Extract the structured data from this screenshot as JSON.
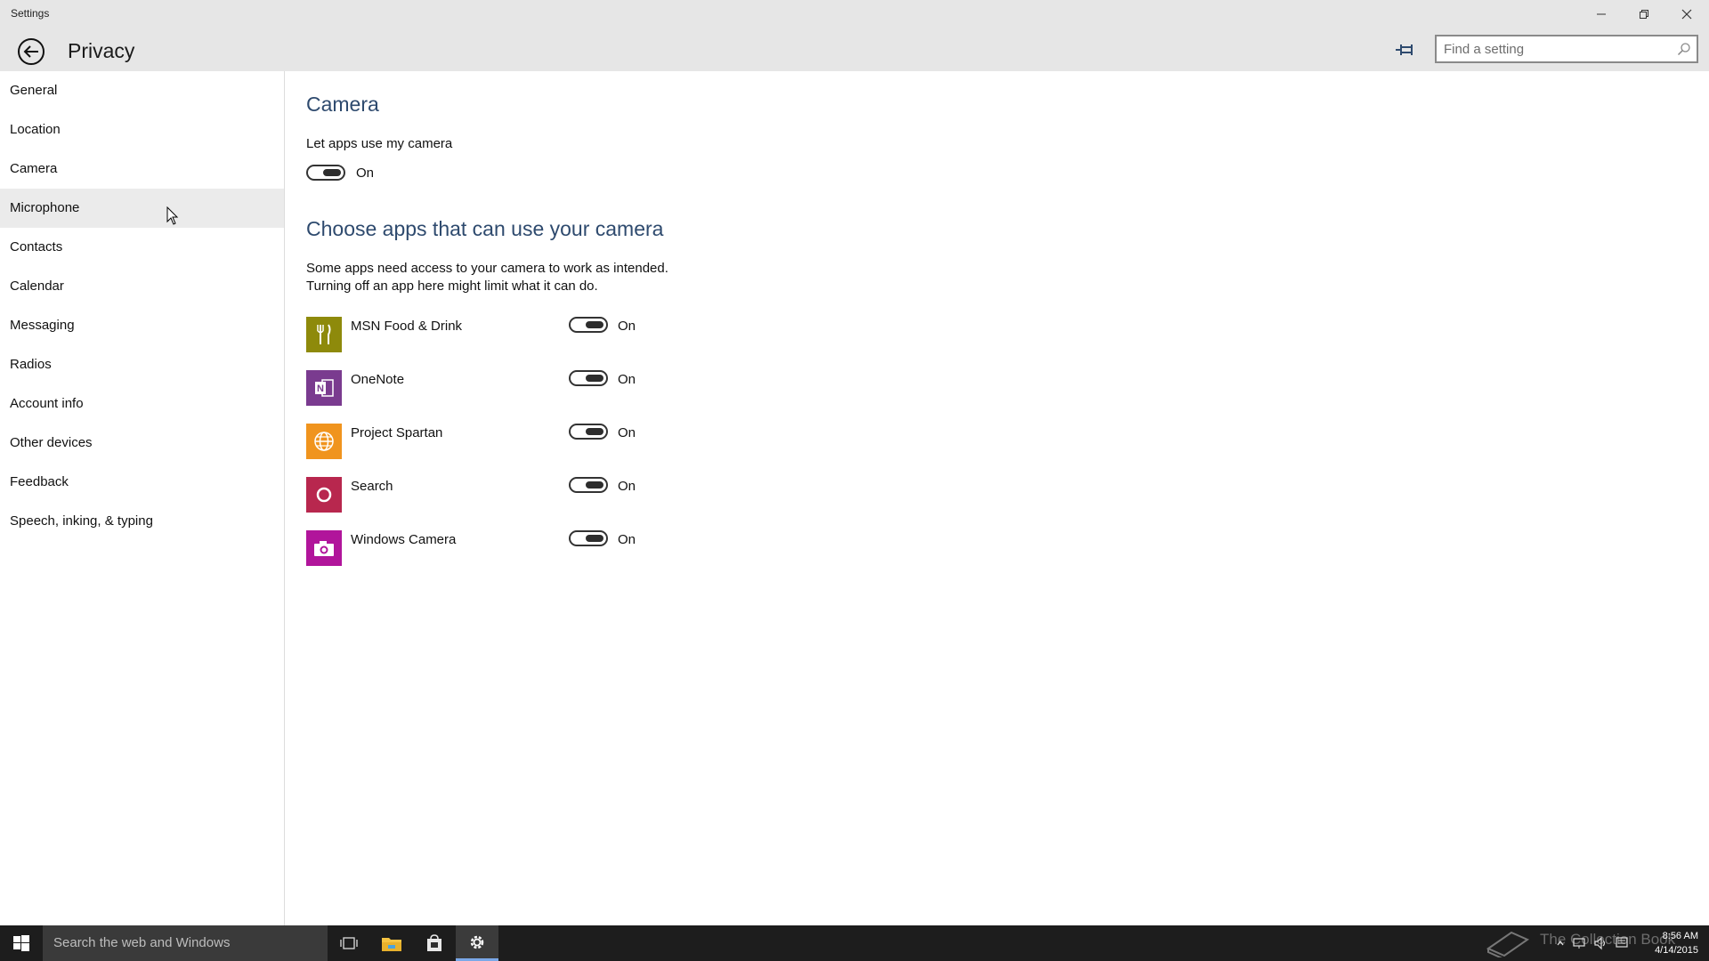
{
  "window": {
    "title": "Settings"
  },
  "header": {
    "title": "Privacy",
    "search_placeholder": "Find a setting"
  },
  "sidebar": {
    "items": [
      {
        "label": "General"
      },
      {
        "label": "Location"
      },
      {
        "label": "Camera"
      },
      {
        "label": "Microphone"
      },
      {
        "label": "Contacts"
      },
      {
        "label": "Calendar"
      },
      {
        "label": "Messaging"
      },
      {
        "label": "Radios"
      },
      {
        "label": "Account info"
      },
      {
        "label": "Other devices"
      },
      {
        "label": "Feedback"
      },
      {
        "label": "Speech, inking, & typing"
      }
    ]
  },
  "content": {
    "camera_heading": "Camera",
    "let_apps_label": "Let apps use my camera",
    "master_toggle_state": "On",
    "choose_heading": "Choose apps that can use your camera",
    "desc_line1": "Some apps need access to your camera to work as intended.",
    "desc_line2": "Turning off an app here might limit what it can do.",
    "apps": [
      {
        "name": "MSN Food & Drink",
        "state": "On",
        "color": "#8e8a0b",
        "icon": "food-drink-icon"
      },
      {
        "name": "OneNote",
        "state": "On",
        "color": "#7a3b8f",
        "icon": "onenote-icon"
      },
      {
        "name": "Project Spartan",
        "state": "On",
        "color": "#f0941e",
        "icon": "globe-icon"
      },
      {
        "name": "Search",
        "state": "On",
        "color": "#b8274e",
        "icon": "search-ring-icon"
      },
      {
        "name": "Windows Camera",
        "state": "On",
        "color": "#b1159b",
        "icon": "camera-icon"
      }
    ]
  },
  "taskbar": {
    "search_placeholder": "Search the web and Windows",
    "watermark": "The Collection Book",
    "time": "8:56 AM",
    "date": "4/14/2015"
  },
  "colors": {
    "accent": "#2e4a6e",
    "titlebar": "#e6e6e6",
    "taskbar": "#1d1d1d"
  }
}
